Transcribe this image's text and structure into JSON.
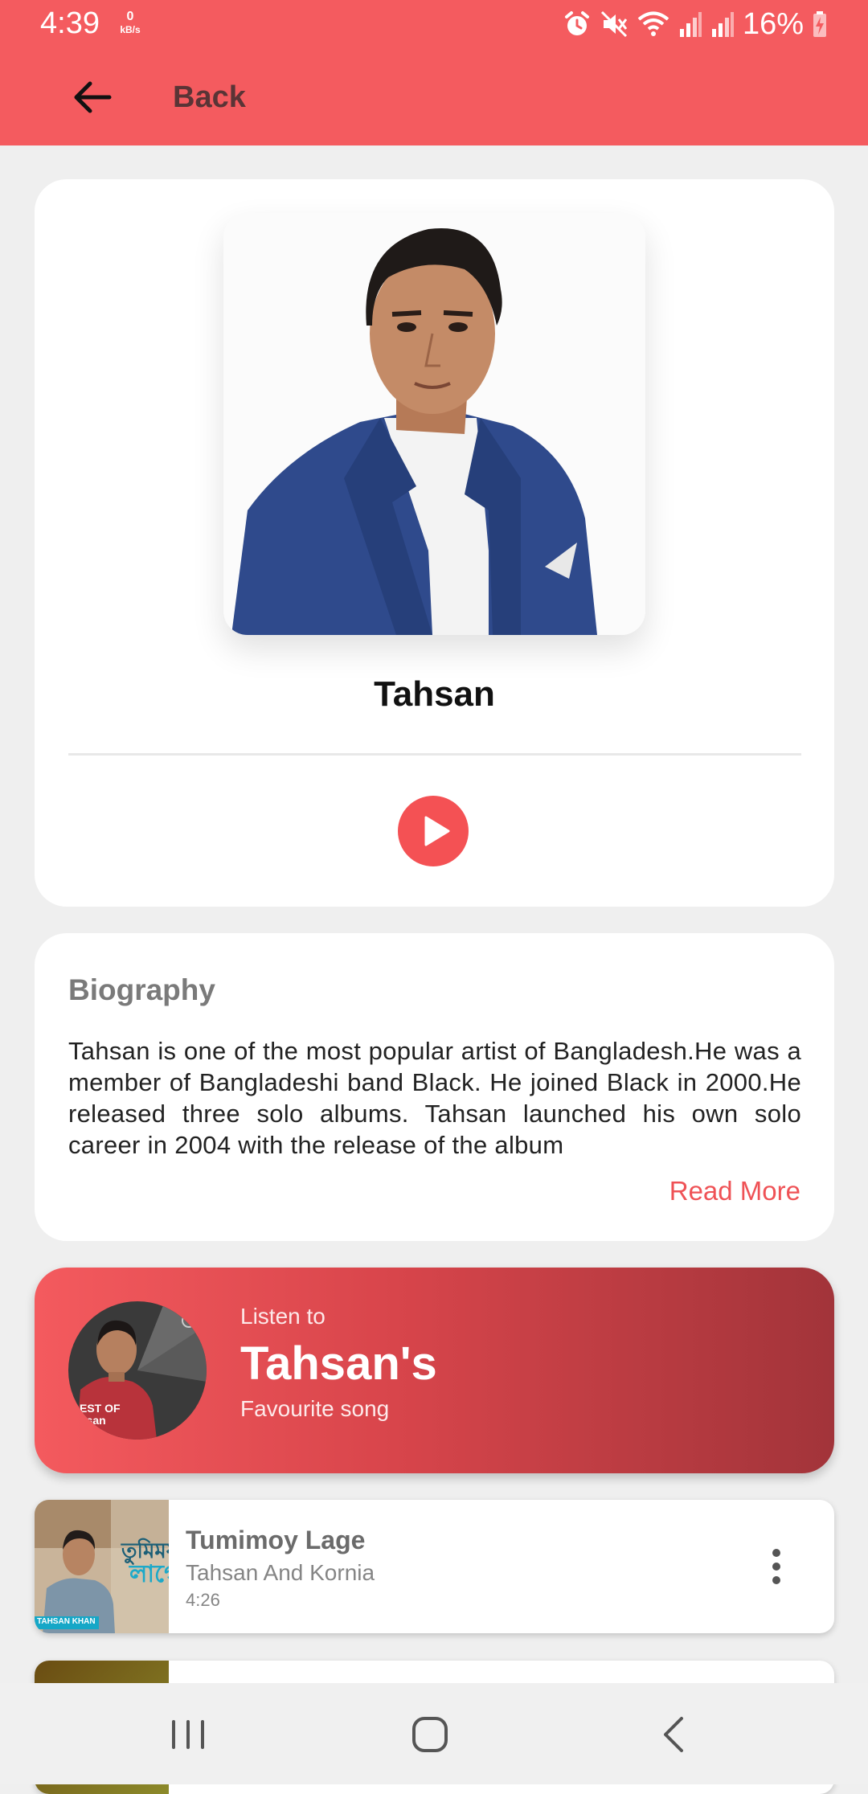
{
  "status": {
    "time": "4:39",
    "speed_value": "0",
    "speed_unit": "kB/s",
    "battery": "16%"
  },
  "appbar": {
    "back_label": "Back"
  },
  "artist": {
    "name": "Tahsan"
  },
  "biography": {
    "title": "Biography",
    "text": "Tahsan is one of the most popular artist of Bangladesh.He was a member of Bangladeshi band Black. He joined Black in 2000.He released three solo albums. Tahsan launched his own solo career in 2004 with the release of the album",
    "read_more": "Read More"
  },
  "favourite": {
    "small": "Listen to",
    "big": "Tahsan's",
    "sub": "Favourite song",
    "avatar_caption": "EST OF hsan"
  },
  "songs": [
    {
      "title": "Tumimoy Lage",
      "artist": "Tahsan And Kornia",
      "duration": "4:26",
      "thumb_text": "TAHSAN KHAN"
    }
  ],
  "colors": {
    "accent": "#f45b5f",
    "play": "#f45154",
    "read_more": "#ef5256",
    "banner_end": "#a2343a"
  }
}
